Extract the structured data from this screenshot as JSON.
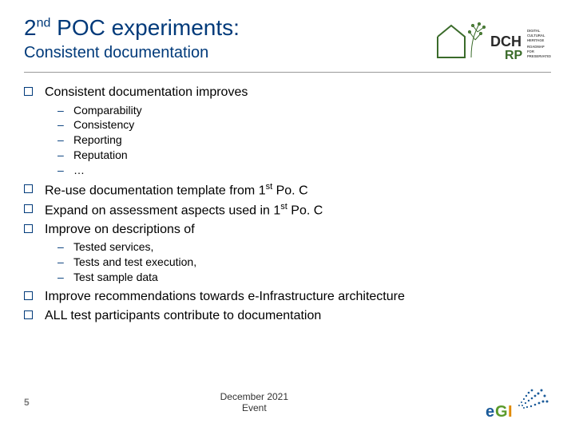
{
  "title_pre": "2",
  "title_sup": "nd",
  "title_post": " POC experiments:",
  "subtitle": "Consistent documentation",
  "bullets": {
    "b0": "Consistent documentation improves",
    "b0_sub": {
      "s0": "Comparability",
      "s1": "Consistency",
      "s2": "Reporting",
      "s3": "Reputation",
      "s4": "…"
    },
    "b1_pre": "Re-use documentation template from 1",
    "b1_sup": "st",
    "b1_post": " Po. C",
    "b2_pre": "Expand on assessment aspects used in 1",
    "b2_sup": "st",
    "b2_post": " Po. C",
    "b3": "Improve on descriptions of",
    "b3_sub": {
      "s0": "Tested services,",
      "s1": "Tests and test execution,",
      "s2": "Test sample data"
    },
    "b4": "Improve recommendations towards e-Infrastructure architecture",
    "b5": "ALL test participants contribute to documentation"
  },
  "footer": {
    "page": "5",
    "event_l1": "December 2021",
    "event_l2": "Event"
  },
  "logos": {
    "dch_main": "DCH",
    "dch_sub": "RP",
    "dch_side1": "DIGITAL",
    "dch_side2": "CULTURAL",
    "dch_side3": "HERITAGE",
    "dch_side4": "ROADMAP",
    "dch_side5": "FOR",
    "dch_side6": "PRESERVATION",
    "egi": "eGI"
  }
}
